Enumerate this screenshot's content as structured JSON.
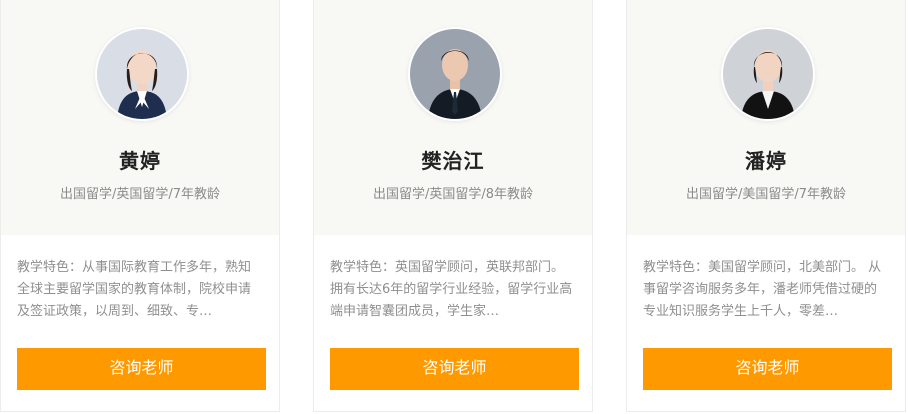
{
  "teachers": [
    {
      "name": "黄婷",
      "tags": "出国留学/英国留学/7年教龄",
      "desc": "教学特色：从事国际教育工作多年，熟知全球主要留学国家的教育体制，院校申请及签证政策，以周到、细致、专…",
      "button": "咨询老师",
      "avatar_icon": "teacher-portrait-female"
    },
    {
      "name": "樊治江",
      "tags": "出国留学/英国留学/8年教龄",
      "desc": "教学特色：英国留学顾问，英联邦部门。 拥有长达6年的留学行业经验，留学行业高端申请智囊团成员，学生家…",
      "button": "咨询老师",
      "avatar_icon": "teacher-portrait-male"
    },
    {
      "name": "潘婷",
      "tags": "出国留学/美国留学/7年教龄",
      "desc": "教学特色：美国留学顾问，北美部门。 从事留学咨询服务多年，潘老师凭借过硬的专业知识服务学生上千人，零差…",
      "button": "咨询老师",
      "avatar_icon": "teacher-portrait-female"
    }
  ],
  "colors": {
    "button_bg": "#ff9900",
    "card_top_bg": "#f8f8f5",
    "name_text": "#222222",
    "muted_text": "#8b8b8b"
  }
}
